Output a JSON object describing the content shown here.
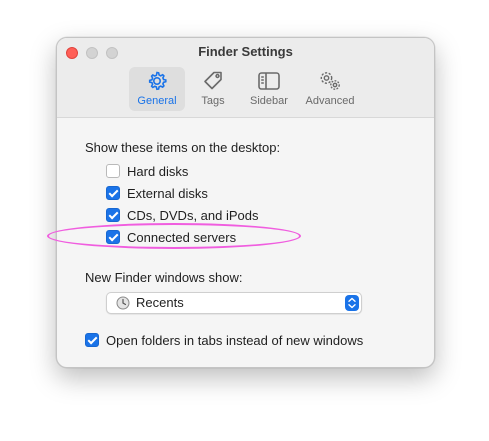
{
  "window": {
    "title": "Finder Settings"
  },
  "tabs": [
    {
      "label": "General",
      "icon": "gear-icon",
      "selected": true
    },
    {
      "label": "Tags",
      "icon": "tag-icon",
      "selected": false
    },
    {
      "label": "Sidebar",
      "icon": "sidebar-icon",
      "selected": false
    },
    {
      "label": "Advanced",
      "icon": "gears-icon",
      "selected": false
    }
  ],
  "desktop": {
    "heading": "Show these items on the desktop:",
    "items": [
      {
        "label": "Hard disks",
        "checked": false
      },
      {
        "label": "External disks",
        "checked": true
      },
      {
        "label": "CDs, DVDs, and iPods",
        "checked": true
      },
      {
        "label": "Connected servers",
        "checked": true
      }
    ]
  },
  "new_windows": {
    "heading": "New Finder windows show:",
    "selected": "Recents",
    "icon": "clock-icon"
  },
  "tabs_option": {
    "label": "Open folders in tabs instead of new windows",
    "checked": true
  },
  "colors": {
    "accent": "#1a73e8",
    "close": "#ff5f57",
    "annotation": "#f05ddf"
  }
}
